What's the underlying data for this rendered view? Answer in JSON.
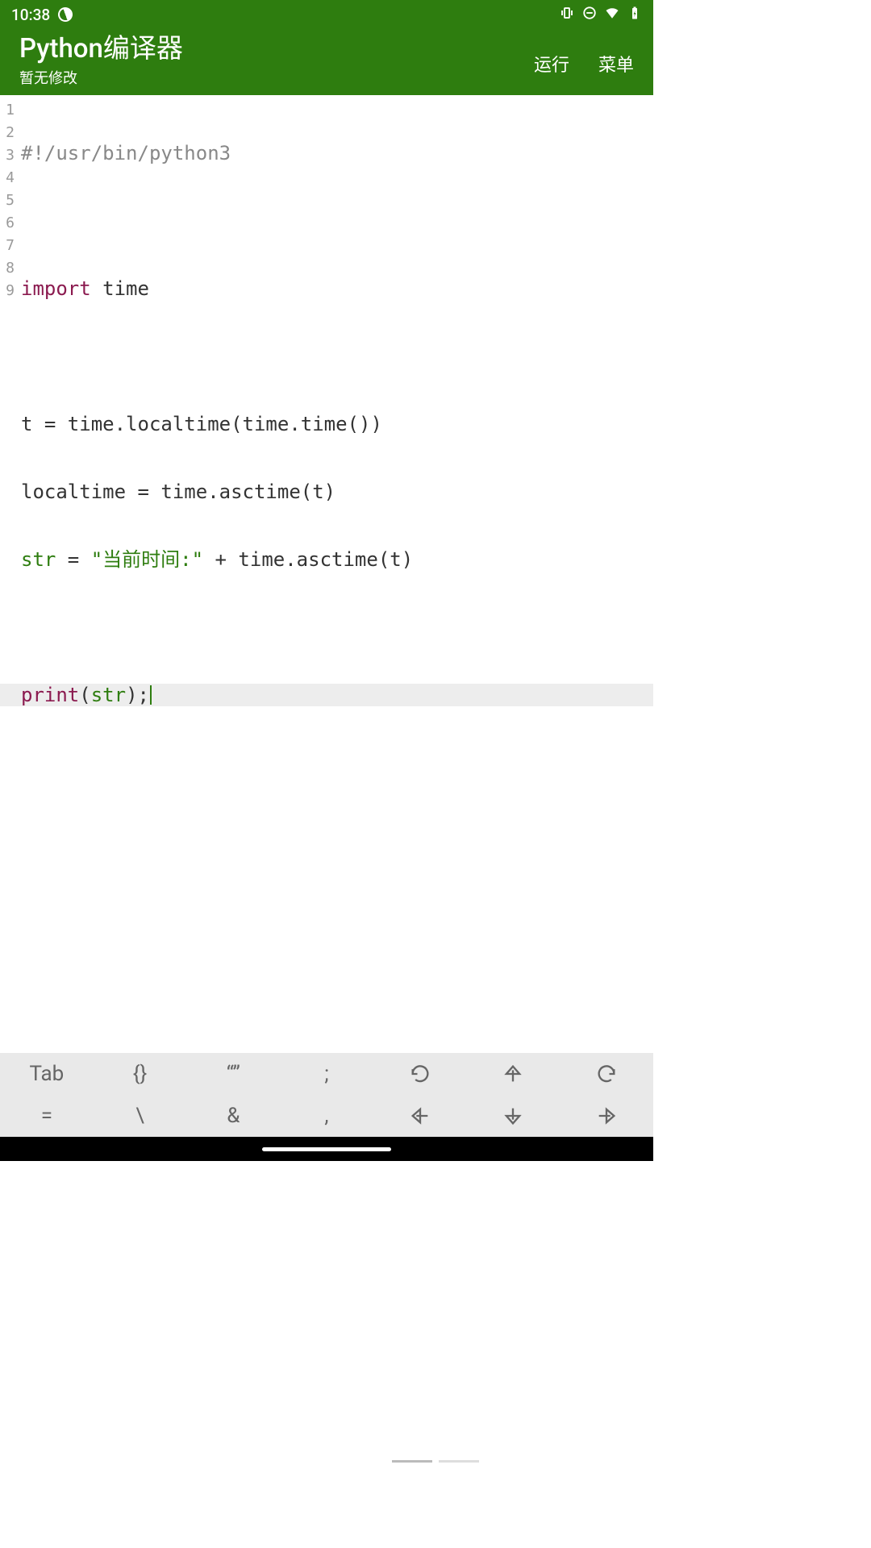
{
  "statusBar": {
    "time": "10:38"
  },
  "header": {
    "title": "Python编译器",
    "subtitle": "暂无修改",
    "run": "运行",
    "menu": "菜单"
  },
  "code": {
    "line1_comment": "#!/usr/bin/python3",
    "line3_import": "import",
    "line3_module": " time",
    "line5": "t = time.localtime(time.time())",
    "line6": "localtime = time.asctime(t)",
    "line7_var": "str",
    "line7_op": " = ",
    "line7_str": "\"当前时间:\"",
    "line7_rest": " + time.asctime(t)",
    "line9_print": "print",
    "line9_paren_o": "(",
    "line9_arg": "str",
    "line9_paren_c": ")",
    "line9_semi": ";"
  },
  "keys": {
    "tab": "Tab",
    "braces": "{}",
    "quotes": "“”",
    "semicolon": ";",
    "eq": "=",
    "backslash": "\\",
    "amp": "&",
    "comma": ","
  },
  "gutter": [
    "1",
    "2",
    "3",
    "4",
    "5",
    "6",
    "7",
    "8",
    "9"
  ]
}
